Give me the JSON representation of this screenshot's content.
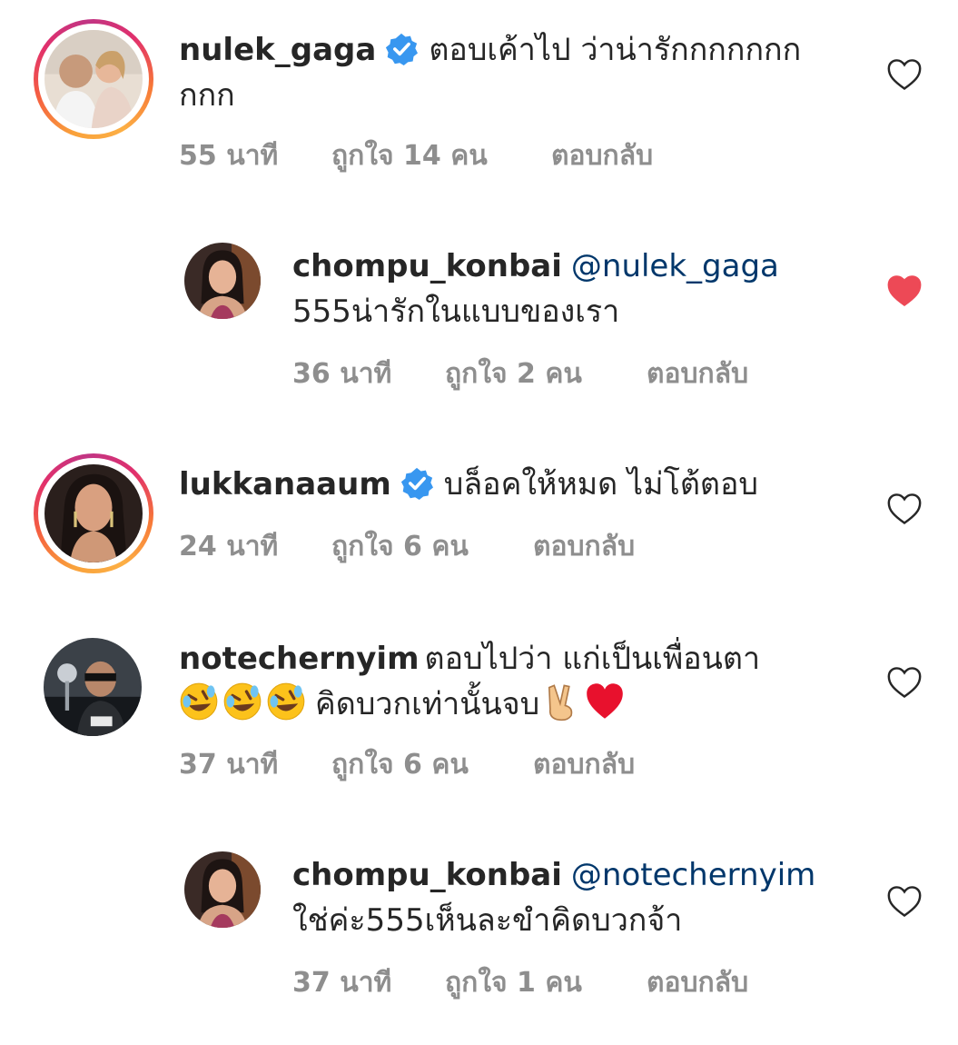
{
  "comments": [
    {
      "username": "nulek_gaga",
      "verified": true,
      "text": "ตอบเค้าไป ว่าน่ารักกกกกกกกกก",
      "time": "55 นาที",
      "likes": "ถูกใจ 14 คน",
      "reply": "ตอบกลับ",
      "liked": false
    },
    {
      "username": "chompu_konbai",
      "mention": "@nulek_gaga",
      "text": "555น่ารักในแบบของเรา",
      "time": "36 นาที",
      "likes": "ถูกใจ 2 คน",
      "reply": "ตอบกลับ",
      "liked": true
    },
    {
      "username": "lukkanaaum",
      "verified": true,
      "text": "บล็อคให้หมด ไม่โต้ตอบ",
      "time": "24 นาที",
      "likes": "ถูกใจ 6 คน",
      "reply": "ตอบกลับ",
      "liked": false
    },
    {
      "username": "notechernyim",
      "text_line1": "ตอบไปว่า แก่เป็นเพื่อนตา",
      "text_line2": "คิดบวกเท่านั้นจบ",
      "time": "37 นาที",
      "likes": "ถูกใจ 6 คน",
      "reply": "ตอบกลับ",
      "liked": false
    },
    {
      "username": "chompu_konbai",
      "mention": "@notechernyim",
      "text": "ใช่ค่ะ555เห็นละขำคิดบวกจ้า",
      "time": "37 นาที",
      "likes": "ถูกใจ 1 คน",
      "reply": "ตอบกลับ",
      "liked": false
    }
  ],
  "colors": {
    "text": "#262626",
    "meta": "#8e8e8e",
    "mention": "#00376b",
    "verified": "#3897f0",
    "liked_heart": "#ed4956"
  },
  "icons": [
    "verified-badge-icon",
    "heart-outline-icon",
    "heart-filled-icon",
    "rolling-laughing-emoji",
    "victory-hand-emoji",
    "red-heart-emoji"
  ]
}
